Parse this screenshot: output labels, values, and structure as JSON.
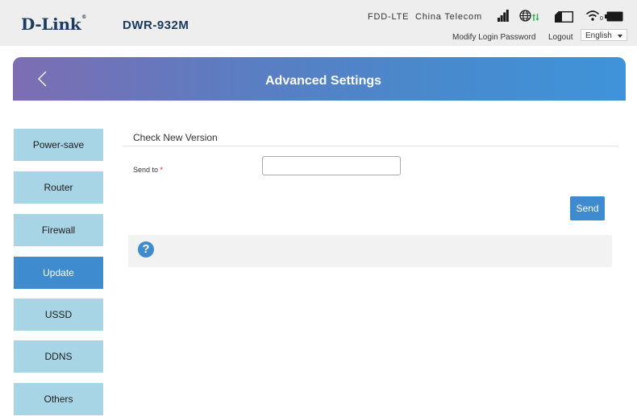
{
  "header": {
    "logo": "D-Link",
    "logo_mark": "®",
    "model": "DWR-932M",
    "network_type": "FDD-LTE",
    "carrier": "China Telecom",
    "wifi_clients": "0",
    "icons": [
      "signal-strength-icon",
      "data-globe-icon",
      "sim-card-icon",
      "wifi-icon",
      "battery-icon"
    ],
    "modify_password_label": "Modify Login Password",
    "logout_label": "Logout",
    "language": "English"
  },
  "titlebar": {
    "title": "Advanced Settings",
    "back_icon": "chevron-left-icon"
  },
  "sidebar": {
    "items": [
      {
        "label": "Power-save"
      },
      {
        "label": "Router"
      },
      {
        "label": "Firewall"
      },
      {
        "label": "Update",
        "active": true
      },
      {
        "label": "USSD"
      },
      {
        "label": "DDNS"
      },
      {
        "label": "Others"
      }
    ]
  },
  "main": {
    "section_title": "Check New Version",
    "send_to_label": "Send to",
    "required_mark": "*",
    "send_to_value": "",
    "send_button": "Send",
    "help_icon_glyph": "?"
  },
  "colors": {
    "accent": "#3e8bd0",
    "sidebar_item": "#a8d5e6",
    "header_bg": "#eeeeee",
    "brand_text": "#1a3b60"
  }
}
